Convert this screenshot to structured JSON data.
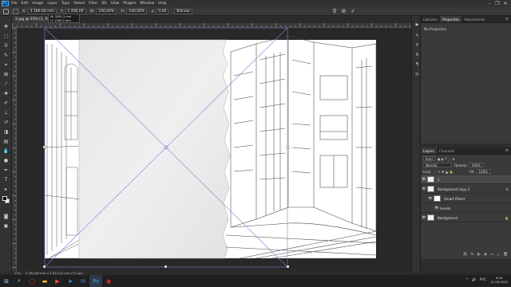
{
  "menubar": {
    "logo": "Ps",
    "items": [
      "File",
      "Edit",
      "Image",
      "Layer",
      "Type",
      "Select",
      "Filter",
      "3D",
      "View",
      "Plugins",
      "Window",
      "Help"
    ],
    "window_controls": [
      "–",
      "❐",
      "✕"
    ]
  },
  "options_bar": {
    "x_value": "3 180,00 mm",
    "y_value": "1 400,00",
    "w_value": "100,00%",
    "h_value": "100,00%",
    "angle_value": "0,00",
    "interp": "Bilinear",
    "angle_symbol": "∠",
    "cancel_symbol": "⊘",
    "commit_symbol": "✓"
  },
  "tooltip": {
    "line1": "W: 3281,3 mm",
    "line2": "H: 1265,9 mm"
  },
  "document_tab": {
    "title": "2.jpg @ 25% (1, RGB/8#)",
    "close": "✕"
  },
  "status_bar": {
    "zoom": "25%",
    "doc_info": "5 784,69 mm x 2 814,42 mm (72 ppi)"
  },
  "right_panel": {
    "top_tabs": [
      "Libraries",
      "Properties",
      "Adjustments"
    ],
    "active_top_tab": "Properties",
    "no_properties": "No Properties",
    "layers_tabs": [
      "Layers",
      "Channels"
    ],
    "active_layers_tab": "Layers",
    "kind_label": "Kind",
    "blend_mode": "Normal",
    "opacity_label": "Opacity:",
    "opacity_value": "100%",
    "lock_label": "Lock:",
    "fill_label": "Fill:",
    "fill_value": "100%",
    "layers": [
      {
        "name": "1",
        "selected": true,
        "fx": ""
      },
      {
        "name": "Background copy 2",
        "selected": false,
        "fx": "⚙"
      },
      {
        "name": "Smart Filters",
        "selected": false,
        "fx": ""
      },
      {
        "name": "Levels",
        "selected": false,
        "fx": ""
      },
      {
        "name": "Background",
        "selected": false,
        "fx": "🔒"
      }
    ],
    "bottom_icons": [
      "⛓",
      "fx",
      "◐",
      "◑",
      "▭",
      "＋",
      "🗑"
    ]
  },
  "taskbar": {
    "clock_time": "9:25",
    "clock_date": "11.09.2022",
    "lang": "РУС",
    "tray_icons": [
      "^",
      "🔊"
    ]
  },
  "colors": {
    "photoshop_blue": "#31a8ff",
    "transform_line": "#7a82d8"
  }
}
